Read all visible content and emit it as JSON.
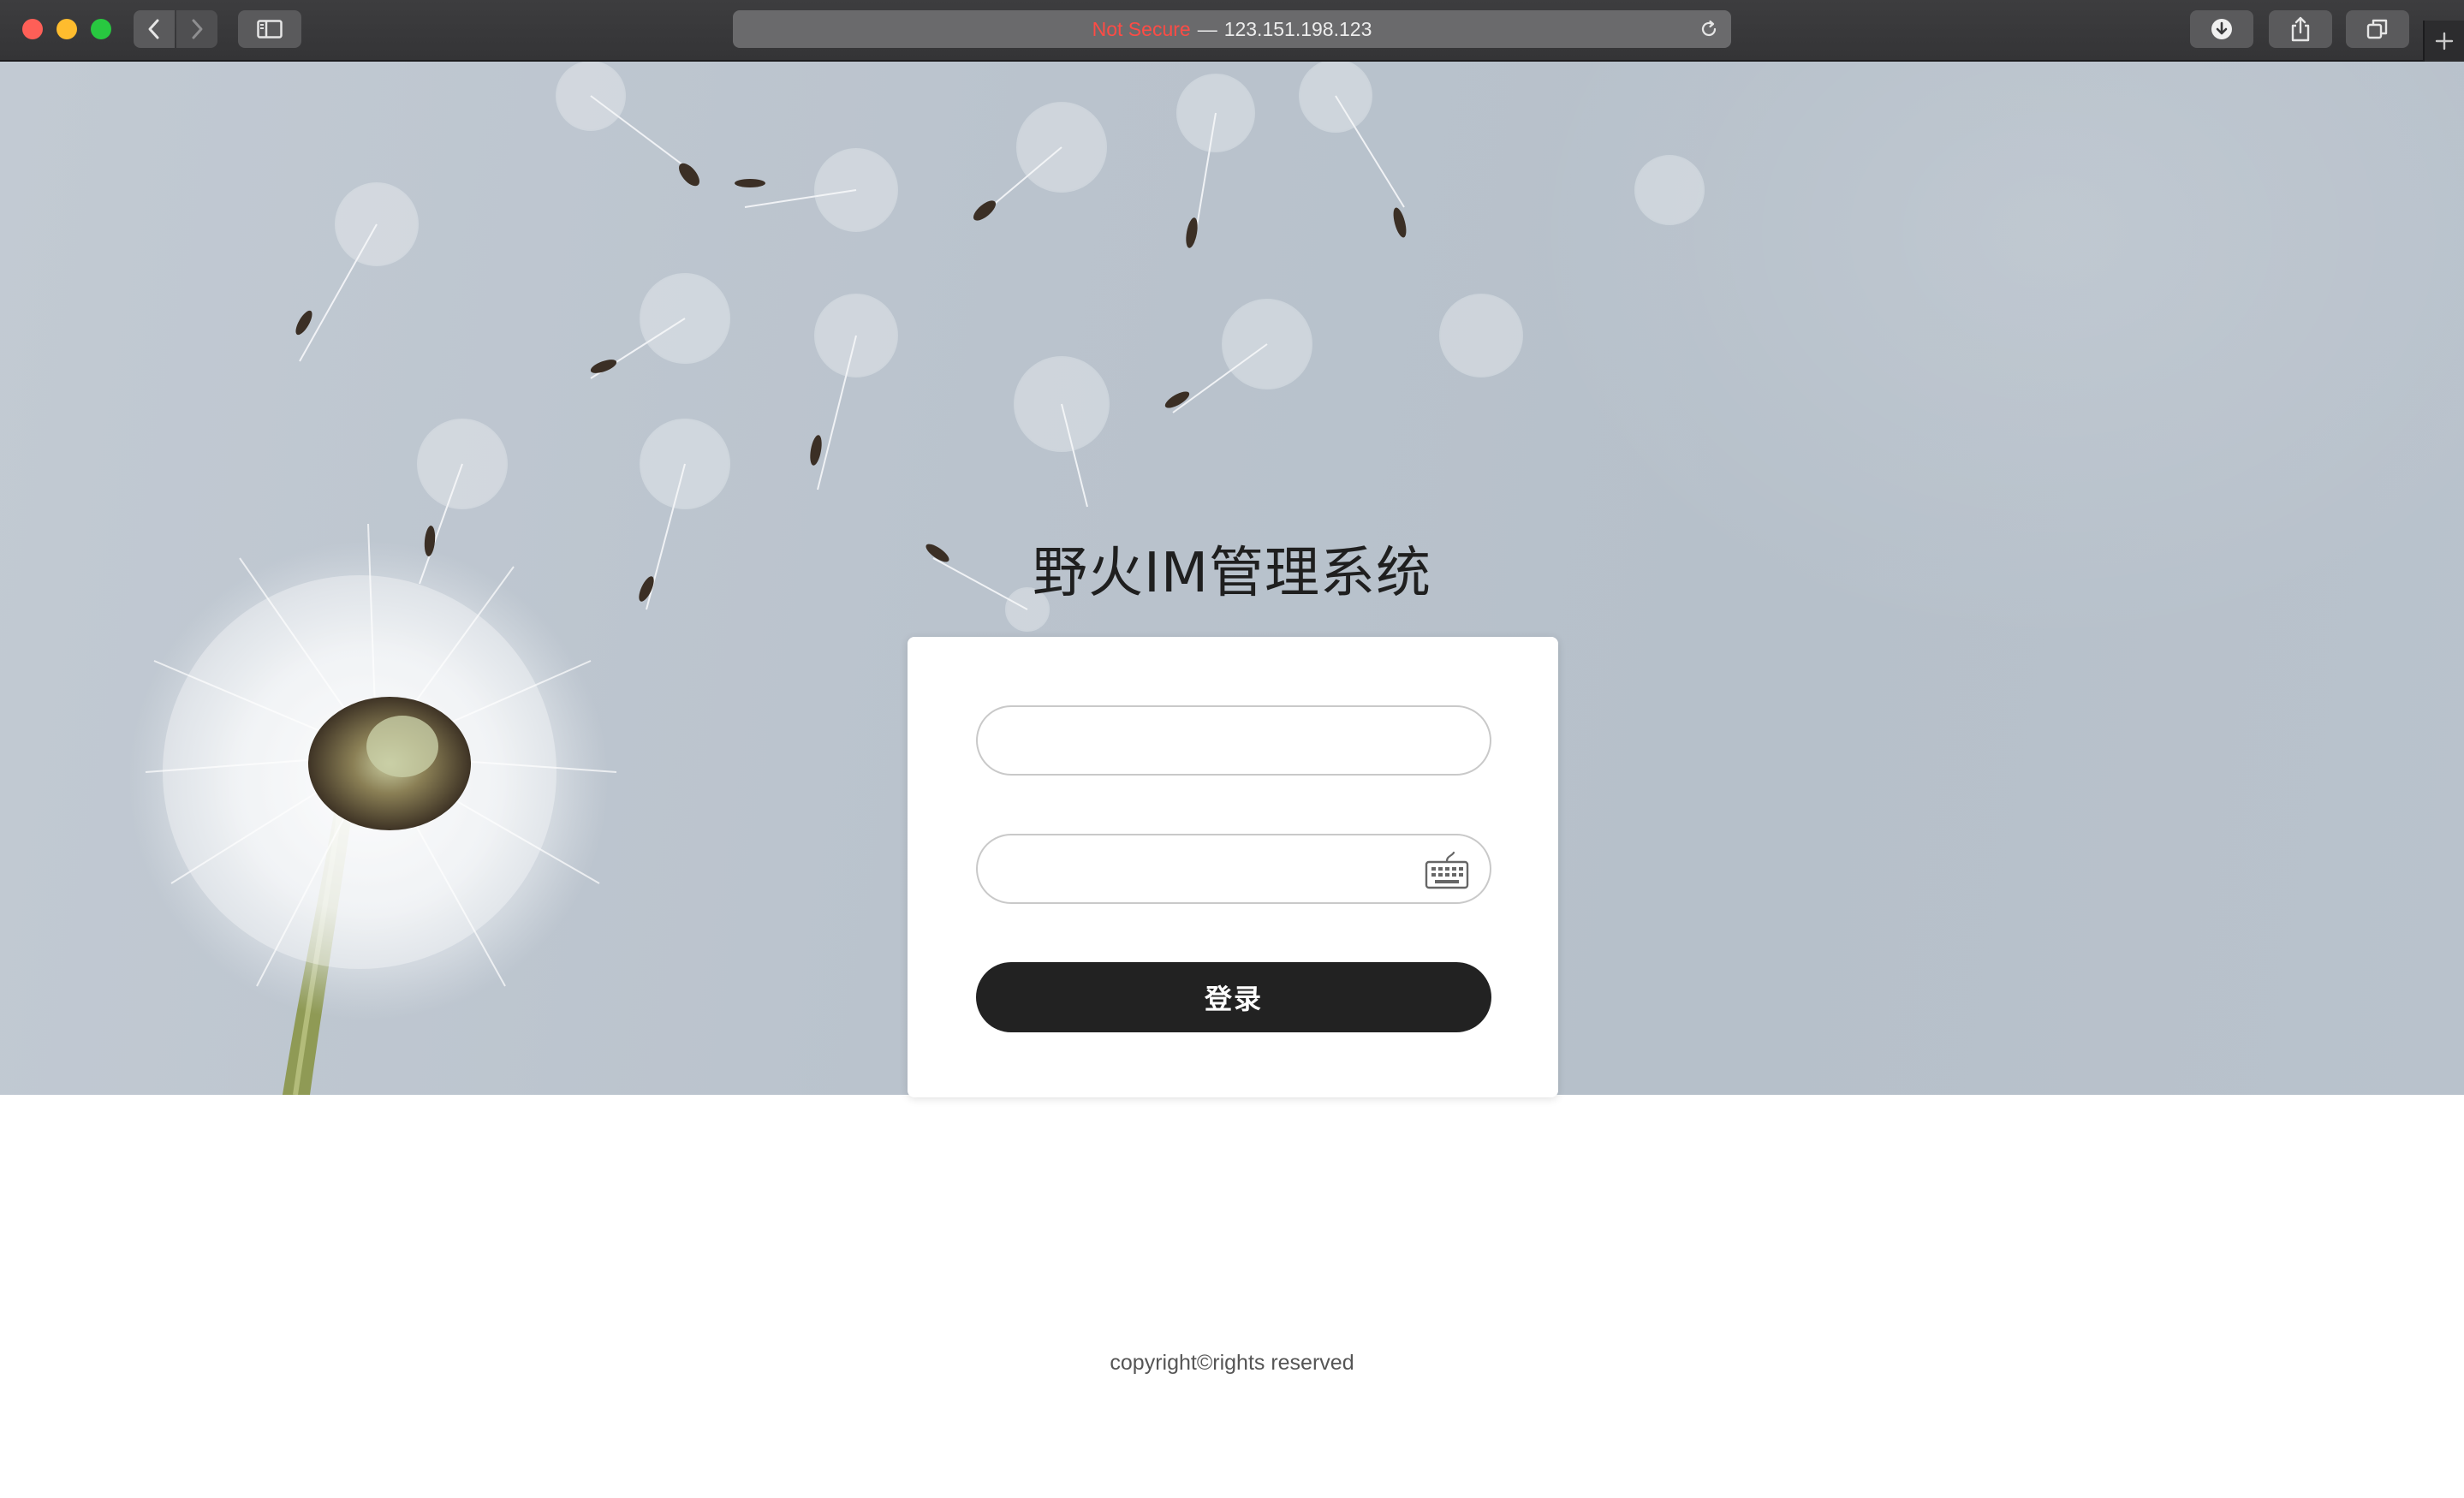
{
  "browser": {
    "address": {
      "security_label": "Not Secure",
      "separator": "—",
      "host": "123.151.198.123"
    },
    "icons": {
      "back": "chevron-left-icon",
      "forward": "chevron-right-icon",
      "sidebar": "sidebar-icon",
      "reload": "reload-icon",
      "download": "download-icon",
      "share": "share-icon",
      "tabs": "tabs-icon",
      "new_tab": "plus-icon"
    },
    "colors": {
      "security_label": "#ff4b45",
      "close": "#fe5f57",
      "minimize": "#febc2e",
      "zoom": "#28c840"
    }
  },
  "page": {
    "title": "野火IM管理系统",
    "login": {
      "username_value": "",
      "password_value": "",
      "keyboard_icon": "keyboard-icon",
      "submit_label": "登录"
    },
    "footer": "copyright©rights reserved",
    "colors": {
      "button": "#222222",
      "background_sky": "#bac3cd"
    }
  }
}
